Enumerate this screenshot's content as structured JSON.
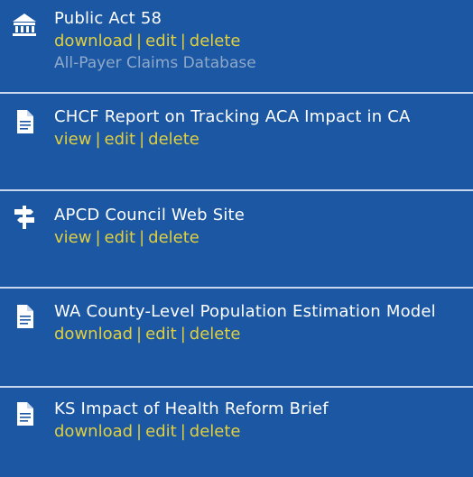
{
  "colors": {
    "background": "#1b57a3",
    "divider": "#c9d8ee",
    "title": "#ffffff",
    "action_link": "#e0cf3f",
    "subtitle": "#8fa9c9"
  },
  "items": [
    {
      "icon": "building-icon",
      "title": "Public Act 58",
      "actions": [
        "download",
        "edit",
        "delete"
      ],
      "subtitle": "All-Payer Claims Database"
    },
    {
      "icon": "document-icon",
      "title": "CHCF Report on Tracking ACA Impact in CA",
      "actions": [
        "view",
        "edit",
        "delete"
      ]
    },
    {
      "icon": "signpost-icon",
      "title": "APCD Council Web Site",
      "actions": [
        "view",
        "edit",
        "delete"
      ]
    },
    {
      "icon": "document-icon",
      "title": "WA County-Level Population Estimation Model",
      "actions": [
        "download",
        "edit",
        "delete"
      ]
    },
    {
      "icon": "document-icon",
      "title": "KS Impact of Health Reform Brief",
      "actions": [
        "download",
        "edit",
        "delete"
      ]
    }
  ],
  "separator": "|"
}
